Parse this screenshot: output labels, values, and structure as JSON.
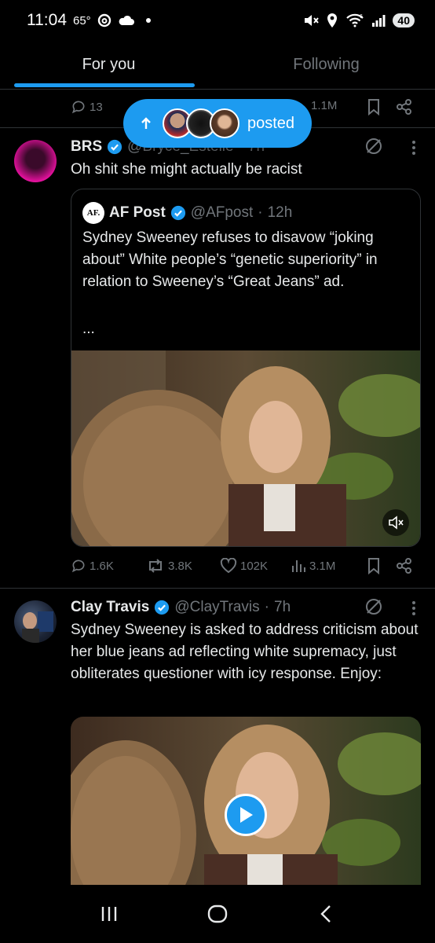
{
  "status_bar": {
    "time": "11:04",
    "temperature": "65°",
    "battery": "40",
    "network": "6"
  },
  "tabs": [
    {
      "label": "For you",
      "active": true
    },
    {
      "label": "Following",
      "active": false
    }
  ],
  "prev_tweet": {
    "replies": "13",
    "views": "1.1M"
  },
  "posted_pill": {
    "label": "posted"
  },
  "tweet1": {
    "name": "BRS",
    "handle": "@Bryce_Estelle",
    "time": "7h",
    "text": "Oh shit she might actually be racist",
    "quote": {
      "logo": "AF.",
      "name": "AF Post",
      "handle": "@AFpost",
      "time": "12h",
      "text": "Sydney Sweeney refuses to disavow “joking about” White people’s “genetic superiority” in relation to Sweeney’s “Great Jeans” ad.",
      "ellipsis": "..."
    },
    "stats": {
      "replies": "1.6K",
      "reposts": "3.8K",
      "likes": "102K",
      "views": "3.1M"
    }
  },
  "tweet2": {
    "name": "Clay Travis",
    "handle": "@ClayTravis",
    "time": "7h",
    "text": "Sydney Sweeney is asked to address criticism about her blue jeans ad reflecting white supremacy, just obliterates questioner with icy response. Enjoy:"
  },
  "colors": {
    "accent": "#1d9bf0",
    "muted": "#71767b",
    "text": "#e7e9ea",
    "divider": "#2f3336",
    "background": "#000000"
  },
  "icons": [
    "reply-icon",
    "repost-icon",
    "like-icon",
    "views-icon",
    "bookmark-icon",
    "share-icon",
    "grok-icon",
    "more-icon",
    "verified-icon",
    "mute-icon",
    "play-icon"
  ]
}
